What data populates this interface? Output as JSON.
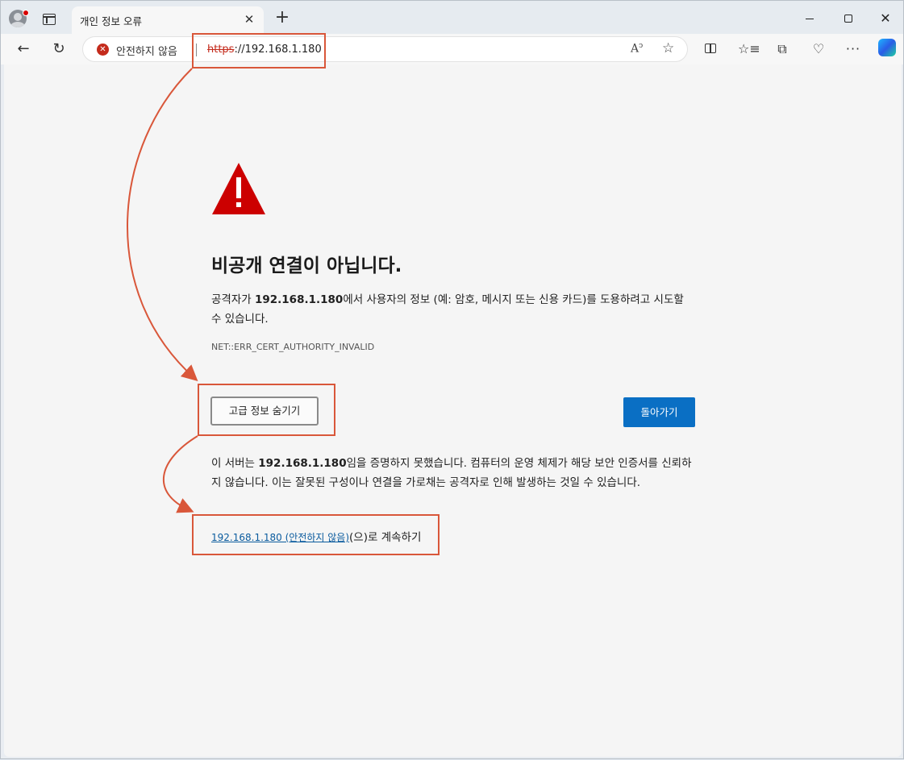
{
  "tab": {
    "title": "개인 정보 오류"
  },
  "omnibox": {
    "security_label": "안전하지 않음",
    "url_scheme": "https",
    "url_rest": "://192.168.1.180"
  },
  "page": {
    "heading": "비공개 연결이 아닙니다.",
    "para1_pre": "공격자가 ",
    "para1_host": "192.168.1.180",
    "para1_post": "에서 사용자의 정보 (예: 암호, 메시지 또는 신용 카드)를 도용하려고 시도할 수 있습니다.",
    "error_code": "NET::ERR_CERT_AUTHORITY_INVALID",
    "advanced_button": "고급 정보 숨기기",
    "back_button": "돌아가기",
    "para2_pre": "이 서버는 ",
    "para2_host": "192.168.1.180",
    "para2_post": "임을 증명하지 못했습니다. 컴퓨터의 운영 체제가 해당 보안 인증서를 신뢰하지 않습니다. 이는 잘못된 구성이나 연결을 가로채는 공격자로 인해 발생하는 것일 수 있습니다.",
    "proceed_link": "192.168.1.180 (안전하지 않음)",
    "proceed_suffix": "(으)로 계속하기"
  },
  "icons": {
    "profile": "profile-avatar-icon",
    "tabs": "tab-actions-icon",
    "security": "not-secure-icon",
    "warning": "warning-triangle-icon"
  },
  "colors": {
    "warning_red": "#cc0000",
    "primary_button": "#0a6fc4",
    "annotation": "#d9573a"
  }
}
